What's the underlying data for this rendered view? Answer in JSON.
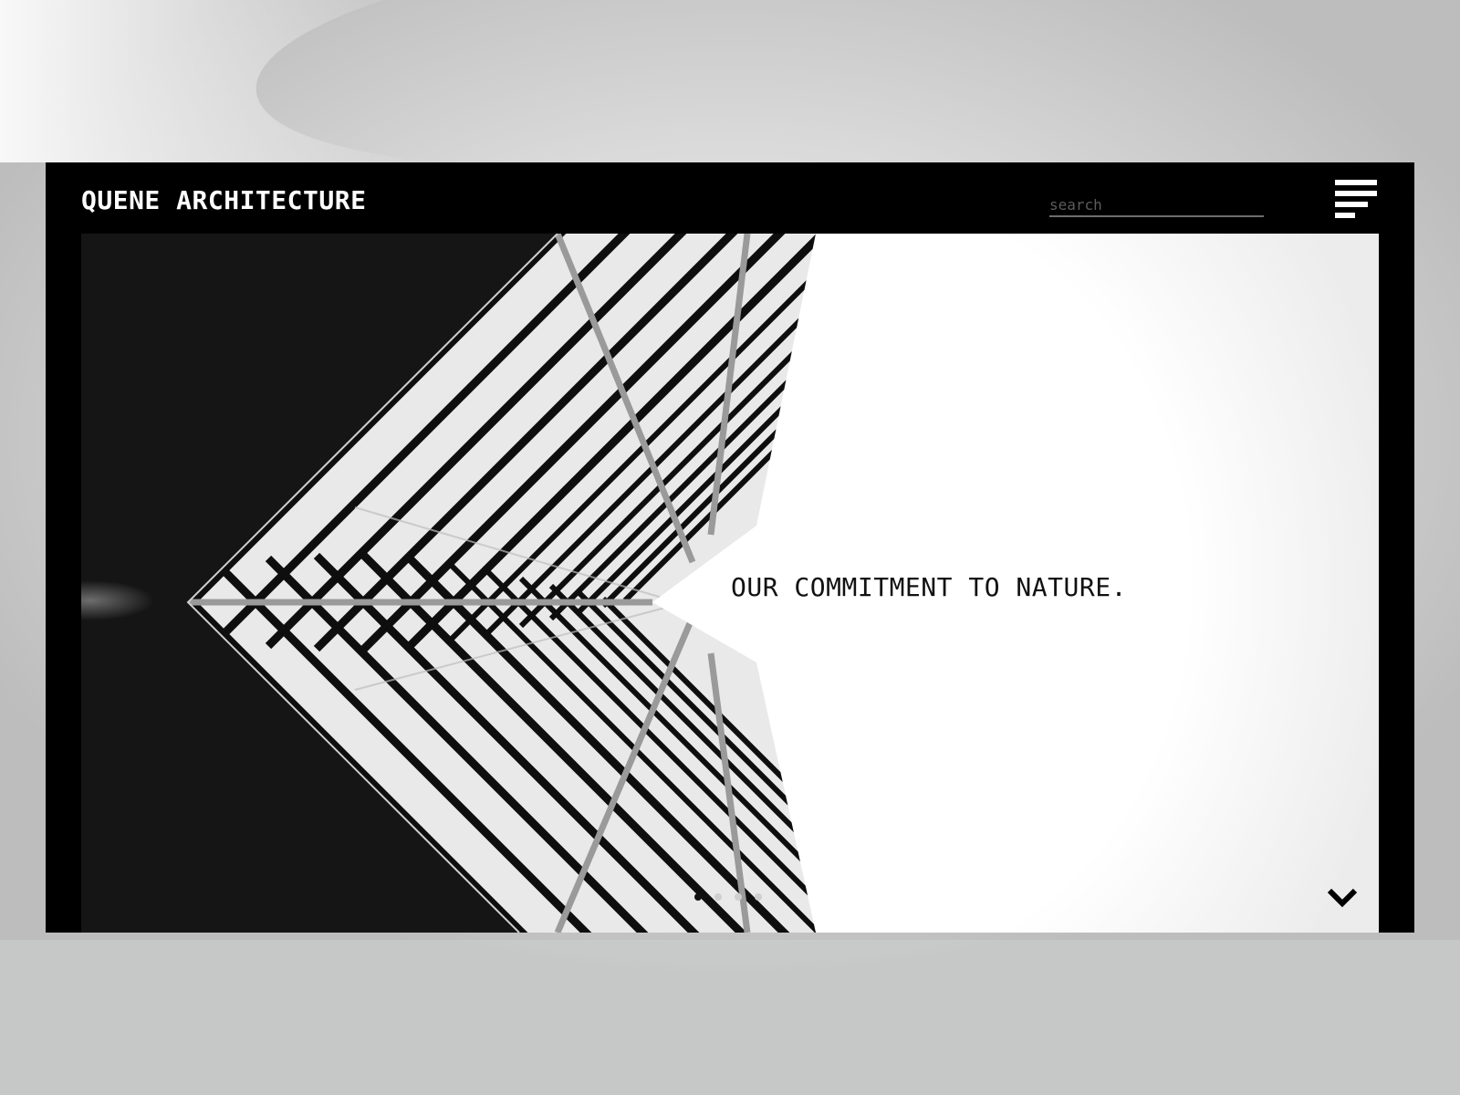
{
  "site": {
    "title": "QUENE ARCHITECTURE"
  },
  "header": {
    "search_placeholder": "search",
    "search_value": "",
    "menu_icon": "hamburger-menu-icon"
  },
  "hero": {
    "heading": "OUR COMMITMENT TO NATURE.",
    "image_subject": "building-facade-photo",
    "slides": {
      "count": 4,
      "active_index": 0
    },
    "scroll_icon": "chevron-down-icon"
  },
  "colors": {
    "frame": "#000000",
    "header_text": "#ffffff",
    "hero_text": "#111111",
    "search_underline": "#6d6d6d",
    "dot_active": "#111111",
    "dot_inactive": "#cfcfcf"
  }
}
